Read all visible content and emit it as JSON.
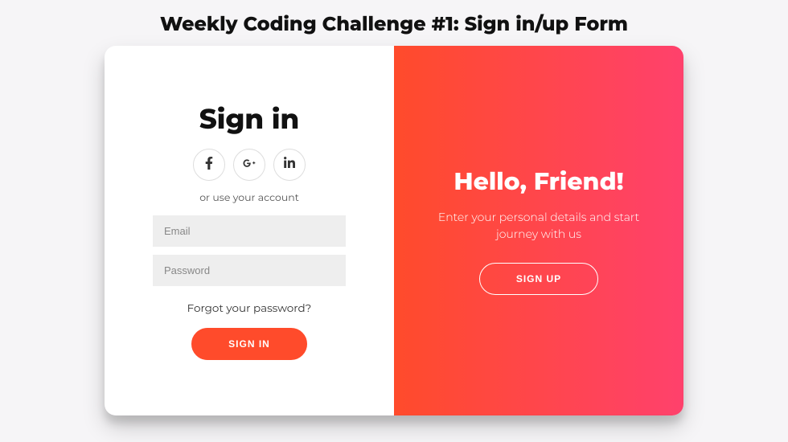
{
  "page": {
    "title": "Weekly Coding Challenge #1: Sign in/up Form"
  },
  "signin": {
    "heading": "Sign in",
    "hint": "or use your account",
    "email_placeholder": "Email",
    "password_placeholder": "Password",
    "forgot": "Forgot your password?",
    "submit": "Sign In"
  },
  "overlay": {
    "heading": "Hello, Friend!",
    "text": "Enter your personal details and start journey with us",
    "button": "Sign Up"
  },
  "social": {
    "facebook": "facebook-icon",
    "google": "google-plus-icon",
    "linkedin": "linkedin-icon"
  },
  "colors": {
    "accent": "#FF4B2B",
    "accent2": "#FF416C"
  }
}
